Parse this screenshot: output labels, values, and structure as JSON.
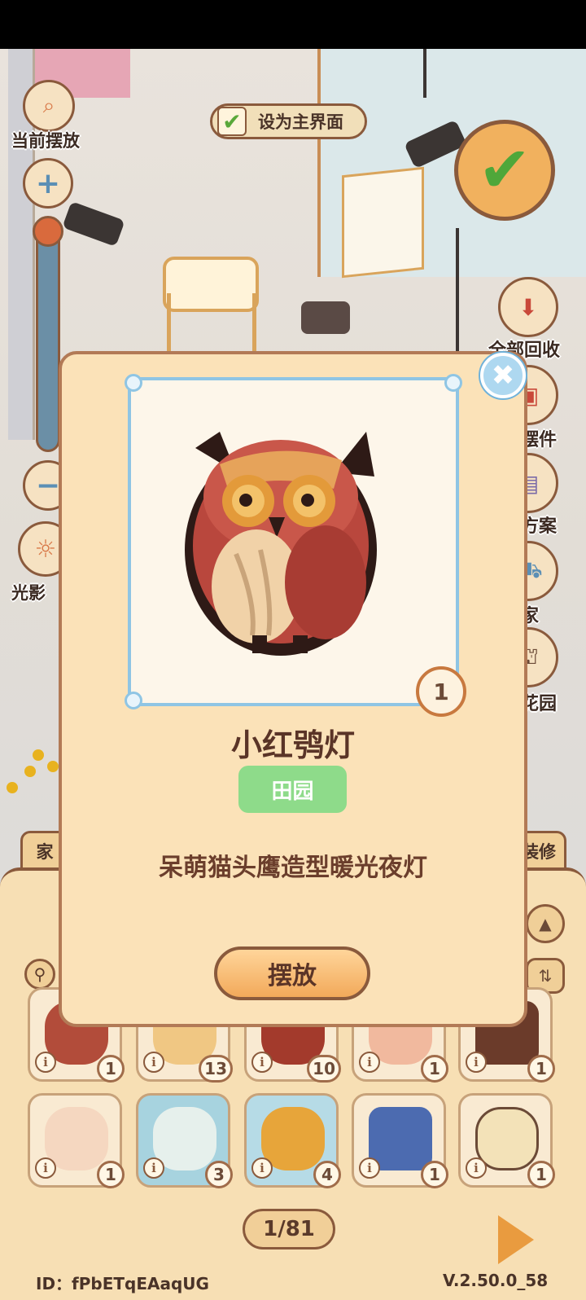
{
  "left_toolbar": {
    "current_layout_label": "当前摆放",
    "lighting_label": "光影"
  },
  "set_main_label": "设为主界面",
  "right_toolbar": {
    "recycle_all_label": "全部回收",
    "item2_label": "摆件",
    "item3_label": "方案",
    "item4_label": "家",
    "item5_label": "花园"
  },
  "bottom_tabs": {
    "left": "家",
    "right": "装修"
  },
  "inventory": [
    {
      "count": "1",
      "icon": "owl-lamp"
    },
    {
      "count": "13",
      "icon": "backpack"
    },
    {
      "count": "10",
      "icon": "red-backpack"
    },
    {
      "count": "1",
      "icon": "shell-lamp"
    },
    {
      "count": "1",
      "icon": "coffee-cup"
    },
    {
      "count": "1",
      "icon": "cake-plate"
    },
    {
      "count": "3",
      "icon": "shaved-ice"
    },
    {
      "count": "4",
      "icon": "fruit-plate"
    },
    {
      "count": "1",
      "icon": "board-game"
    },
    {
      "count": "1",
      "icon": "lantern"
    }
  ],
  "pager": "1/81",
  "footer": {
    "id": "ID：fPbETqEAaqUG",
    "version": "V.2.50.0_58"
  },
  "dialog": {
    "quantity": "1",
    "item_name": "小红鸮灯",
    "tag": "田园",
    "description": "呆萌猫头鹰造型暖光夜灯",
    "place_button": "摆放"
  }
}
